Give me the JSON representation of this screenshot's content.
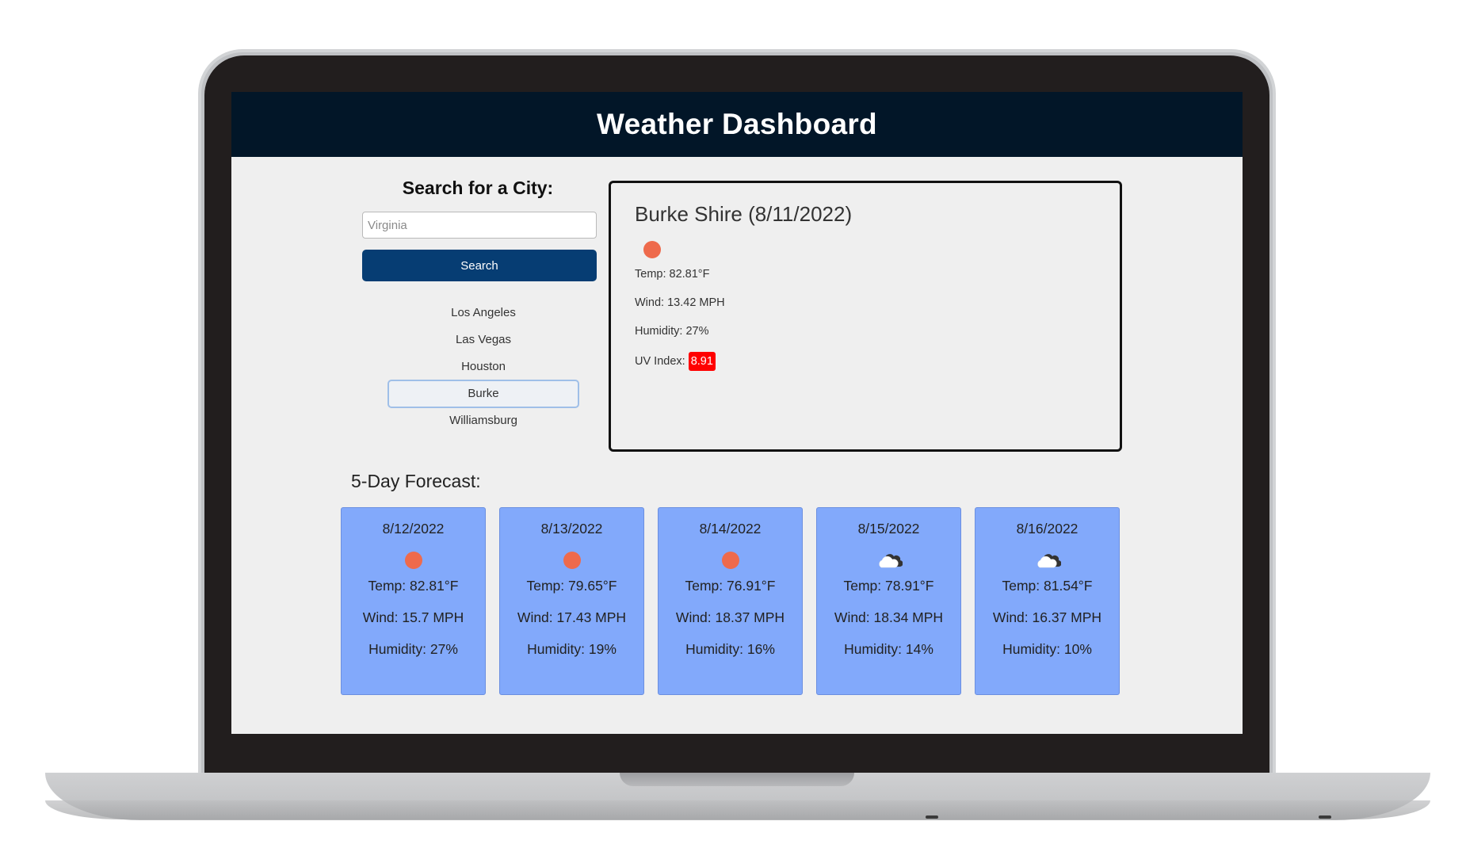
{
  "app": {
    "title": "Weather Dashboard"
  },
  "search": {
    "title": "Search for a City:",
    "placeholder": "Virginia",
    "button_label": "Search",
    "history": [
      "Los Angeles",
      "Las Vegas",
      "Houston",
      "Burke",
      "Williamsburg"
    ],
    "active_history": "Burke"
  },
  "current": {
    "title": "Burke Shire (8/11/2022)",
    "icon": "sun-icon",
    "temp": "Temp: 82.81°F",
    "wind": "Wind: 13.42 MPH",
    "humidity": "Humidity: 27%",
    "uv_label": "UV Index:",
    "uv_value": "8.91",
    "uv_color": "#ff0000"
  },
  "forecast": {
    "title": "5-Day Forecast:",
    "days": [
      {
        "date": "8/12/2022",
        "icon": "sun-icon",
        "temp": "Temp: 82.81°F",
        "wind": "Wind: 15.7 MPH",
        "humidity": "Humidity: 27%"
      },
      {
        "date": "8/13/2022",
        "icon": "sun-icon",
        "temp": "Temp: 79.65°F",
        "wind": "Wind: 17.43 MPH",
        "humidity": "Humidity: 19%"
      },
      {
        "date": "8/14/2022",
        "icon": "sun-icon",
        "temp": "Temp: 76.91°F",
        "wind": "Wind: 18.37 MPH",
        "humidity": "Humidity: 16%"
      },
      {
        "date": "8/15/2022",
        "icon": "cloud-icon",
        "temp": "Temp: 78.91°F",
        "wind": "Wind: 18.34 MPH",
        "humidity": "Humidity: 14%"
      },
      {
        "date": "8/16/2022",
        "icon": "cloud-icon",
        "temp": "Temp: 81.54°F",
        "wind": "Wind: 16.37 MPH",
        "humidity": "Humidity: 10%"
      }
    ]
  },
  "colors": {
    "header_bg": "#021628",
    "button_bg": "#063d73",
    "forecast_card_bg": "#82a9fb",
    "sun_icon": "#ee6a4c"
  }
}
